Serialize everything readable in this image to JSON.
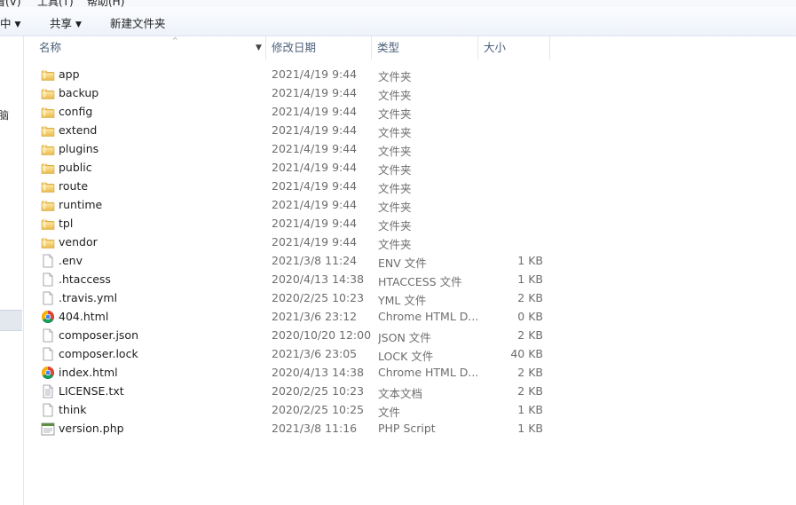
{
  "menubar": {
    "items": [
      "看(V)",
      "工具(T)",
      "帮助(H)"
    ]
  },
  "toolbar": {
    "include_label": "中",
    "share_label": "共享",
    "new_folder_label": "新建文件夹"
  },
  "columns": {
    "name": "名称",
    "date": "修改日期",
    "type": "类型",
    "size": "大小"
  },
  "files": [
    {
      "name": "app",
      "date": "2021/4/19 9:44",
      "type": "文件夹",
      "size": "",
      "icon": "folder-icon"
    },
    {
      "name": "backup",
      "date": "2021/4/19 9:44",
      "type": "文件夹",
      "size": "",
      "icon": "folder-icon"
    },
    {
      "name": "config",
      "date": "2021/4/19 9:44",
      "type": "文件夹",
      "size": "",
      "icon": "folder-icon"
    },
    {
      "name": "extend",
      "date": "2021/4/19 9:44",
      "type": "文件夹",
      "size": "",
      "icon": "folder-icon"
    },
    {
      "name": "plugins",
      "date": "2021/4/19 9:44",
      "type": "文件夹",
      "size": "",
      "icon": "folder-icon"
    },
    {
      "name": "public",
      "date": "2021/4/19 9:44",
      "type": "文件夹",
      "size": "",
      "icon": "folder-icon"
    },
    {
      "name": "route",
      "date": "2021/4/19 9:44",
      "type": "文件夹",
      "size": "",
      "icon": "folder-icon"
    },
    {
      "name": "runtime",
      "date": "2021/4/19 9:44",
      "type": "文件夹",
      "size": "",
      "icon": "folder-icon"
    },
    {
      "name": "tpl",
      "date": "2021/4/19 9:44",
      "type": "文件夹",
      "size": "",
      "icon": "folder-icon"
    },
    {
      "name": "vendor",
      "date": "2021/4/19 9:44",
      "type": "文件夹",
      "size": "",
      "icon": "folder-icon"
    },
    {
      "name": ".env",
      "date": "2021/3/8 11:24",
      "type": "ENV 文件",
      "size": "1 KB",
      "icon": "file-icon"
    },
    {
      "name": ".htaccess",
      "date": "2020/4/13 14:38",
      "type": "HTACCESS 文件",
      "size": "1 KB",
      "icon": "file-icon"
    },
    {
      "name": ".travis.yml",
      "date": "2020/2/25 10:23",
      "type": "YML 文件",
      "size": "2 KB",
      "icon": "file-icon"
    },
    {
      "name": "404.html",
      "date": "2021/3/6 23:12",
      "type": "Chrome HTML D...",
      "size": "0 KB",
      "icon": "chrome-icon"
    },
    {
      "name": "composer.json",
      "date": "2020/10/20 12:00",
      "type": "JSON 文件",
      "size": "2 KB",
      "icon": "file-icon"
    },
    {
      "name": "composer.lock",
      "date": "2021/3/6 23:05",
      "type": "LOCK 文件",
      "size": "40 KB",
      "icon": "file-icon"
    },
    {
      "name": "index.html",
      "date": "2020/4/13 14:38",
      "type": "Chrome HTML D...",
      "size": "2 KB",
      "icon": "chrome-icon"
    },
    {
      "name": "LICENSE.txt",
      "date": "2020/2/25 10:23",
      "type": "文本文档",
      "size": "2 KB",
      "icon": "text-file-icon"
    },
    {
      "name": "think",
      "date": "2020/2/25 10:25",
      "type": "文件",
      "size": "1 KB",
      "icon": "file-icon"
    },
    {
      "name": "version.php",
      "date": "2021/3/8 11:16",
      "type": "PHP Script",
      "size": "1 KB",
      "icon": "php-file-icon"
    }
  ]
}
